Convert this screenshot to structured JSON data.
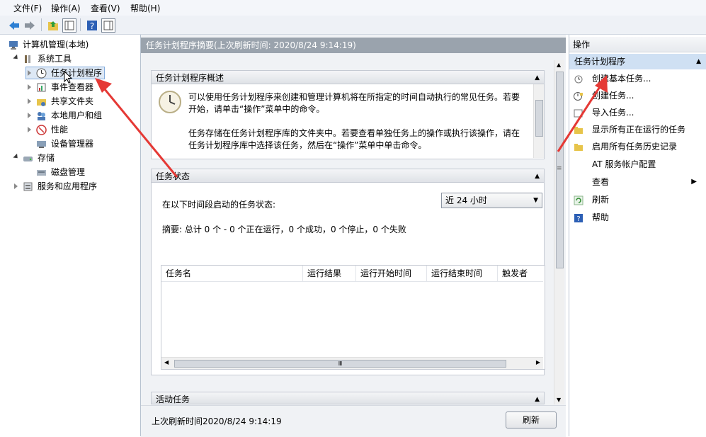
{
  "menu": [
    "文件(F)",
    "操作(A)",
    "查看(V)",
    "帮助(H)"
  ],
  "toolbar_icons": [
    "back-icon",
    "forward-icon",
    "up-folder-icon",
    "show-hide-tree-icon",
    "help-icon",
    "show-hide-action-icon"
  ],
  "tree": {
    "root": "计算机管理(本地)",
    "system_tools": "系统工具",
    "task_scheduler": "任务计划程序",
    "event_viewer": "事件查看器",
    "shared_folders": "共享文件夹",
    "local_users": "本地用户和组",
    "performance": "性能",
    "device_manager": "设备管理器",
    "storage": "存储",
    "disk_management": "磁盘管理",
    "services_apps": "服务和应用程序"
  },
  "center": {
    "header": "任务计划程序摘要(上次刷新时间: 2020/8/24 9:14:19)",
    "overview_title": "任务计划程序概述",
    "overview_p1_line1": "可以使用任务计划程序来创建和管理计算机将在所指定的时间自动执行的常见任务。若要",
    "overview_p1_line2": "开始，请单击“操作”菜单中的命令。",
    "overview_p2_line1": "任务存储在任务计划程序库的文件夹中。若要查看单独任务上的操作或执行该操作，请在",
    "overview_p2_line2": "任务计划程序库中选择该任务，然后在“操作”菜单中单击命令。",
    "status_title": "任务状态",
    "status_label": "在以下时间段启动的任务状态:",
    "status_select": "近 24 小时",
    "summary": "摘要: 总计 0 个 - 0 个正在运行，0 个成功，0 个停止，0 个失败",
    "columns": [
      "任务名",
      "运行结果",
      "运行开始时间",
      "运行结束时间",
      "触发者"
    ],
    "active_title": "活动任务",
    "footer": "上次刷新时间2020/8/24 9:14:19",
    "refresh_button": "刷新",
    "scroll_thumb": "Ⅲ",
    "grip": "≡"
  },
  "actions": {
    "header": "操作",
    "section": "任务计划程序",
    "items": [
      {
        "label": "创建基本任务...",
        "icon": "clock-icon"
      },
      {
        "label": "创建任务...",
        "icon": "task-icon"
      },
      {
        "label": "导入任务...",
        "icon": "import-icon"
      },
      {
        "label": "显示所有正在运行的任务",
        "icon": "folder-icon"
      },
      {
        "label": "启用所有任务历史记录",
        "icon": "folder-icon"
      },
      {
        "label": "AT 服务帐户配置",
        "icon": ""
      },
      {
        "label": "查看",
        "icon": ""
      },
      {
        "label": "刷新",
        "icon": "refresh-icon"
      },
      {
        "label": "帮助",
        "icon": "help-icon"
      }
    ]
  },
  "colors": {
    "accent": "#dde8f5",
    "header_gray": "#9aa3ad",
    "arrow_red": "#e53935"
  }
}
